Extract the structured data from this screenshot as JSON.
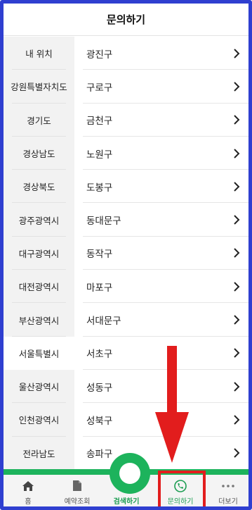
{
  "header": {
    "title": "문의하기"
  },
  "sidebar": {
    "items": [
      {
        "label": "내 위치",
        "active": false
      },
      {
        "label": "강원특별자치도",
        "active": false
      },
      {
        "label": "경기도",
        "active": false
      },
      {
        "label": "경상남도",
        "active": false
      },
      {
        "label": "경상북도",
        "active": false
      },
      {
        "label": "광주광역시",
        "active": false
      },
      {
        "label": "대구광역시",
        "active": false
      },
      {
        "label": "대전광역시",
        "active": false
      },
      {
        "label": "부산광역시",
        "active": false
      },
      {
        "label": "서울특별시",
        "active": true
      },
      {
        "label": "울산광역시",
        "active": false
      },
      {
        "label": "인천광역시",
        "active": false
      },
      {
        "label": "전라남도",
        "active": false
      }
    ]
  },
  "list": {
    "items": [
      "광진구",
      "구로구",
      "금천구",
      "노원구",
      "도봉구",
      "동대문구",
      "동작구",
      "마포구",
      "서대문구",
      "서초구",
      "성동구",
      "성북구",
      "송파구"
    ]
  },
  "tabbar": {
    "home": "홈",
    "reservation": "예약조회",
    "search": "검색하기",
    "inquiry": "문의하기",
    "more": "더보기"
  },
  "colors": {
    "frame": "#2f3fd0",
    "accent_green": "#1db35c",
    "highlight_red": "#e21d1d"
  }
}
